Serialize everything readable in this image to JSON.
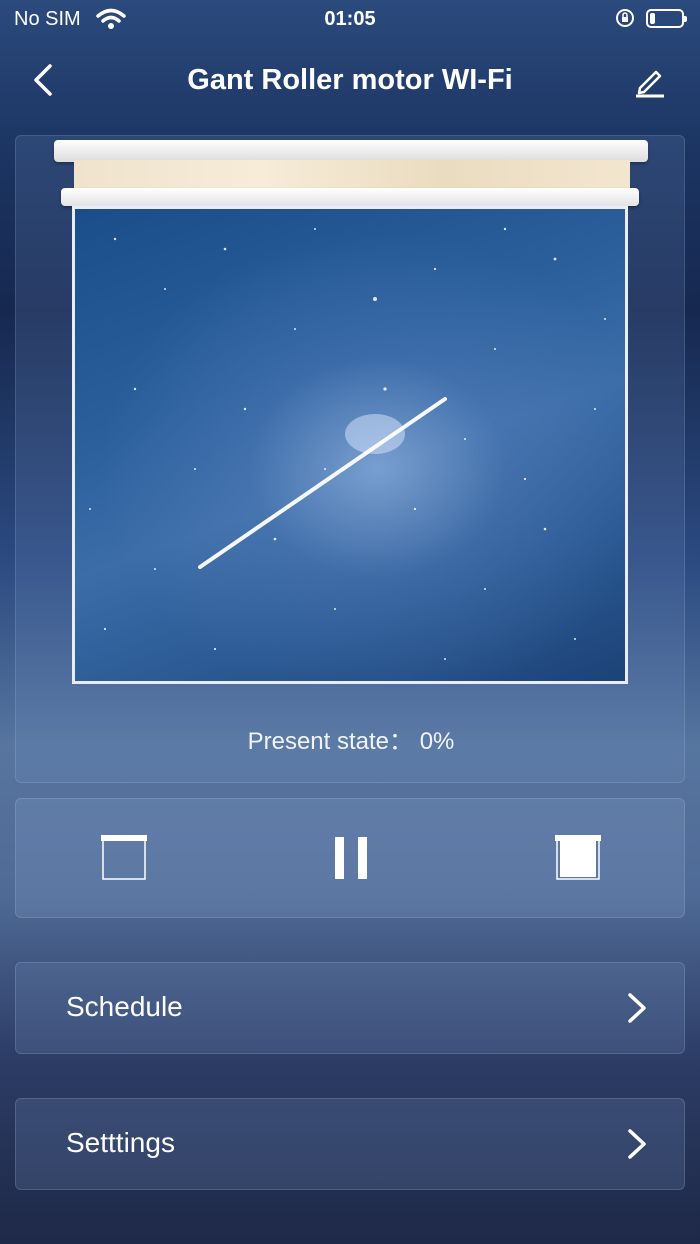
{
  "status_bar": {
    "carrier": "No SIM",
    "time": "01:05",
    "icons": [
      "wifi-icon",
      "orientation-lock-icon",
      "battery-icon"
    ]
  },
  "header": {
    "title": "Gant Roller motor WI-Fi",
    "back_icon": "chevron-left-icon",
    "edit_icon": "pencil-icon"
  },
  "curtain": {
    "present_state_label": "Present state：",
    "present_state_value": "0%",
    "open_fraction": 0
  },
  "controls": {
    "open_icon": "curtain-open-icon",
    "pause_icon": "pause-icon",
    "close_icon": "curtain-close-icon"
  },
  "menu": {
    "schedule_label": "Schedule",
    "settings_label": "Setttings",
    "chevron_icon": "chevron-right-icon"
  }
}
